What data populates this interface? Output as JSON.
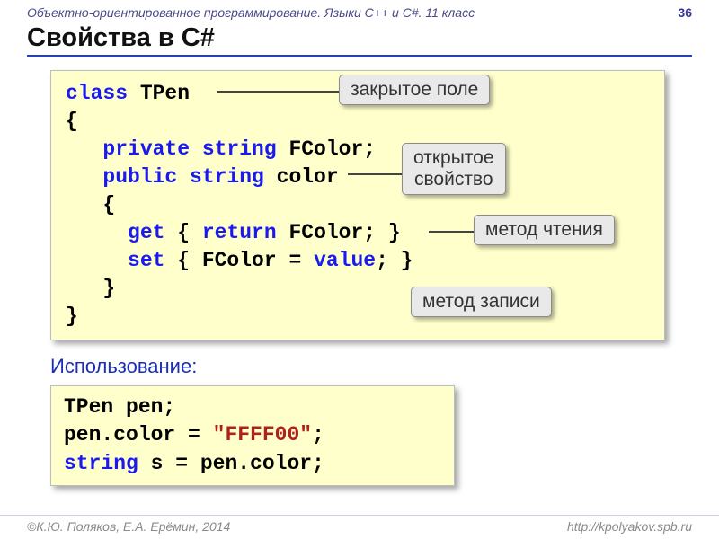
{
  "header": {
    "course": "Объектно-ориентированное программирование. Языки C++ и C#. 11 класс",
    "page": "36"
  },
  "title": "Свойства в C#",
  "code1": {
    "l1a": "class",
    "l1b": " TPen",
    "l2": "{",
    "l3a": "   private string",
    "l3b": " FColor;",
    "l4a": "   public string",
    "l4b": " color",
    "l5": "   {",
    "l6a": "     get",
    "l6b": " { ",
    "l6c": "return",
    "l6d": " FColor; }",
    "l7a": "     set",
    "l7b": " { FColor = ",
    "l7c": "value",
    "l7d": "; }",
    "l8": "   }",
    "l9": "}"
  },
  "labels": {
    "privateField": "закрытое поле",
    "publicProp1": "открытое",
    "publicProp2": "свойство",
    "getter": "метод чтения",
    "setter": "метод записи"
  },
  "subtitle": "Использование",
  "code2": {
    "l1": "TPen pen;",
    "l2a": "pen.color = ",
    "l2b": "\"FFFF00\"",
    "l2c": ";",
    "l3a": "string",
    "l3b": " s = pen.color;"
  },
  "footer": {
    "authors": "К.Ю. Поляков, Е.А. Ерёмин, 2014",
    "url": "http://kpolyakov.spb.ru"
  }
}
